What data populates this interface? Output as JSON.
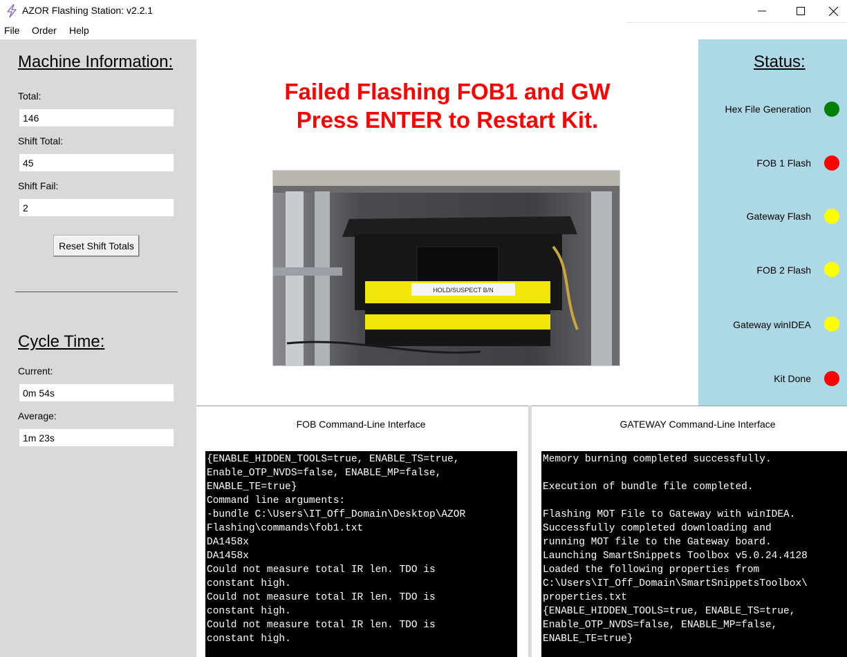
{
  "window": {
    "title": "AZOR Flashing Station: v2.2.1",
    "minimize_glyph": "—",
    "maximize_glyph": "☐",
    "close_glyph": "✕"
  },
  "menu": {
    "items": [
      "File",
      "Order",
      "Help"
    ]
  },
  "machine_info": {
    "heading": "Machine Information:",
    "total_label": "Total:",
    "total_value": "146",
    "shift_total_label": "Shift Total:",
    "shift_total_value": "45",
    "shift_fail_label": "Shift Fail:",
    "shift_fail_value": "2",
    "reset_button": "Reset Shift Totals"
  },
  "cycle_time": {
    "heading": "Cycle Time:",
    "current_label": "Current:",
    "current_value": "0m 54s",
    "average_label": "Average:",
    "average_value": "1m 23s"
  },
  "message": {
    "line1": "Failed Flashing FOB1 and GW",
    "line2": "Press ENTER to Restart Kit.",
    "color": "#ff0000"
  },
  "photo": {
    "label_text": "HOLD/SUSPECT B/N"
  },
  "status": {
    "heading": "Status:",
    "items": [
      {
        "label": "Hex File Generation",
        "color": "#008000"
      },
      {
        "label": "FOB 1 Flash",
        "color": "#ff0000"
      },
      {
        "label": "Gateway Flash",
        "color": "#ffff00"
      },
      {
        "label": "FOB 2 Flash",
        "color": "#ffff00"
      },
      {
        "label": "Gateway winIDEA",
        "color": "#ffff00"
      },
      {
        "label": "Kit Done",
        "color": "#ff0000"
      }
    ]
  },
  "fob_cli": {
    "title": "FOB Command-Line Interface",
    "lines": [
      "{ENABLE_HIDDEN_TOOLS=true, ENABLE_TS=true,",
      "Enable_OTP_NVDS=false, ENABLE_MP=false,",
      "ENABLE_TE=true}",
      "Command line arguments:",
      "-bundle C:\\Users\\IT_Off_Domain\\Desktop\\AZOR",
      "Flashing\\commands\\fob1.txt",
      "DA1458x",
      "DA1458x",
      "Could not measure total IR len. TDO is",
      "constant high.",
      "Could not measure total IR len. TDO is",
      "constant high.",
      "Could not measure total IR len. TDO is",
      "constant high."
    ]
  },
  "gateway_cli": {
    "title": "GATEWAY Command-Line Interface",
    "lines": [
      "Memory burning completed successfully.",
      "",
      "Execution of bundle file completed.",
      "",
      "Flashing MOT File to Gateway with winIDEA.",
      "Successfully completed downloading and",
      "running MOT file to the Gateway board.",
      "Launching SmartSnippets Toolbox v5.0.24.4128",
      "Loaded the following properties from",
      "C:\\Users\\IT_Off_Domain\\SmartSnippetsToolbox\\",
      "properties.txt",
      "{ENABLE_HIDDEN_TOOLS=true, ENABLE_TS=true,",
      "Enable_OTP_NVDS=false, ENABLE_MP=false,",
      "ENABLE_TE=true}"
    ]
  }
}
